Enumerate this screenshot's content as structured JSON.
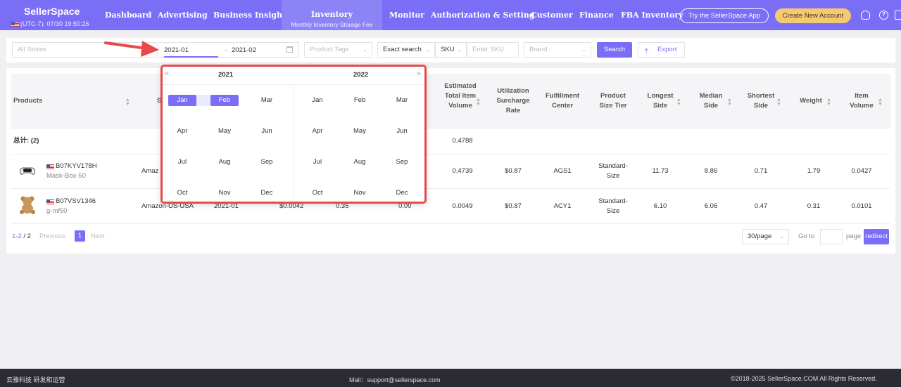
{
  "header": {
    "logo": "SellerSpace",
    "timezone": "(UTC-7): 07/30 19:50:26",
    "nav": [
      "Dashboard",
      "Advertising",
      "Business Insight",
      "Monitor",
      "Authorization & Setting",
      "Customer",
      "Finance",
      "FBA Inventory"
    ],
    "active_nav": {
      "title": "Inventory",
      "subtitle": "Monthly Inventory Storage Fee"
    },
    "try_app": "Try the SellerSpace App",
    "create_account": "Create New Account",
    "icons": [
      "headset-icon",
      "help-icon",
      "translate-icon"
    ]
  },
  "filters": {
    "stores_placeholder": "All Stores",
    "date_start": "2021-01",
    "date_end": "2021-02",
    "tags_placeholder": "Product Tags",
    "search_mode": "Exact search",
    "sku_label": "SKU",
    "sku_placeholder": "Enter SKU",
    "brand_placeholder": "Brand",
    "search_button": "Search",
    "export_button": "Export"
  },
  "calendar": {
    "left_year": "2021",
    "right_year": "2022",
    "prev": "«",
    "next": "»",
    "months": [
      "Jan",
      "Feb",
      "Mar",
      "Apr",
      "May",
      "Jun",
      "Jul",
      "Aug",
      "Sep",
      "Oct",
      "Nov",
      "Dec"
    ],
    "selected_start": "Jan",
    "selected_end": "Feb"
  },
  "table": {
    "headers": {
      "products": "Products",
      "est_volume": "Estimated Total Item Volume",
      "utilization": "Utilization Surcharge Rate",
      "fc": "Fulfillment Center",
      "size_tier": "Product Size Tier",
      "longest": "Longest Side",
      "median": "Median Side",
      "shortest": "Shortest Side",
      "weight": "Weight",
      "item_volume": "Item Volume"
    },
    "total": {
      "label": "总计: (2)",
      "est_volume": "0.4788"
    },
    "rows": [
      {
        "asin": "B07KYV178H",
        "sku": "Mask-Box-50",
        "store": "Amaz",
        "est_volume": "0.4739",
        "utilization": "$0.87",
        "fc": "AGS1",
        "size_tier": "Standard-Size",
        "longest": "11.73",
        "median": "8.86",
        "shortest": "0.71",
        "weight": "1.79",
        "item_volume": "0.0427"
      },
      {
        "asin": "B07VSV1346",
        "sku": "g-mf50",
        "store": "Amazon-US-USA",
        "month": "2021-01",
        "fee": "$0.0042",
        "col5": "0.35",
        "col6": "0.00",
        "est_volume": "0.0049",
        "utilization": "$0.87",
        "fc": "ACY1",
        "size_tier": "Standard-Size",
        "longest": "6.10",
        "median": "6.06",
        "shortest": "0.47",
        "weight": "0.31",
        "item_volume": "0.0101"
      }
    ]
  },
  "pagination": {
    "range": "1-2",
    "total": "2",
    "previous": "Previous",
    "page": "1",
    "next": "Next",
    "page_size": "30/page",
    "goto": "Go to",
    "page_label": "page",
    "redirect": "redirect"
  },
  "footer": {
    "left": "云雅科技 研发和运营",
    "mail": "Mail：support@sellerspace.com",
    "copyright": "©2018-2025 SellerSpace.COM All Rights Reserved."
  }
}
